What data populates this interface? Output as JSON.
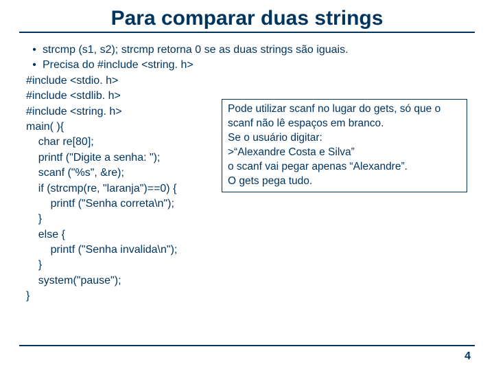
{
  "title": "Para comparar duas strings",
  "bullets": [
    {
      "prefix": "strcmp (s1, s2);     ",
      "text": "strcmp retorna 0 se as duas strings são iguais."
    },
    {
      "prefix": "",
      "text": "Precisa do #include <string. h>"
    }
  ],
  "code": "#include <stdio. h>\n#include <stdlib. h>\n#include <string. h>\nmain( ){\n    char re[80];\n    printf (\"Digite a senha: \");\n    scanf (\"%s\", &re);\n    if (strcmp(re, \"laranja\")==0) {\n        printf (\"Senha correta\\n\");\n    }\n    else {\n        printf (\"Senha invalida\\n\");\n    }\n    system(\"pause\");\n}",
  "note": {
    "l1": "Pode utilizar scanf no lugar do gets, só que o",
    "l2": "scanf não lê espaços em branco.",
    "l3": "Se o usuário digitar:",
    "l4": ">“Alexandre Costa e Silva”",
    "l5": "o scanf vai pegar apenas “Alexandre”.",
    "l6": "O gets pega tudo."
  },
  "page_number": "4"
}
